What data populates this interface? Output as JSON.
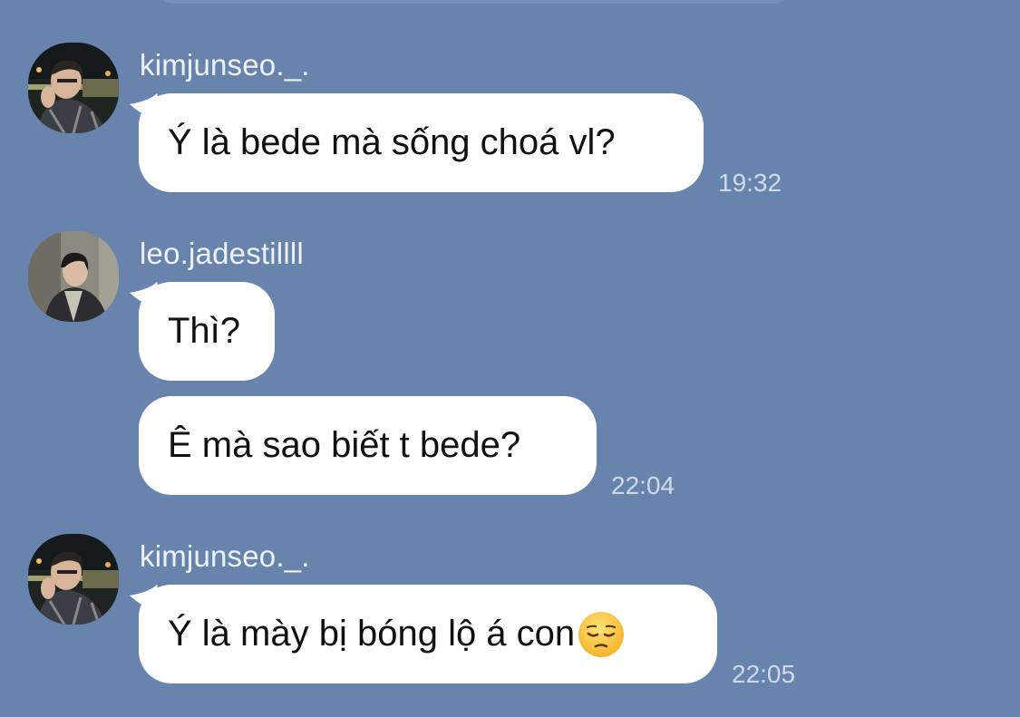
{
  "colors": {
    "background": "#6884ad",
    "bubble": "#ffffff",
    "username_text": "#eef2f8",
    "time_text": "#cfdae9"
  },
  "messages": [
    {
      "sender": "kimjunseo._.",
      "avatar": "avatar-kimjunseo",
      "bubbles": [
        {
          "text": "Ý là bede mà sống choá vl?"
        }
      ],
      "time": "19:32"
    },
    {
      "sender": "leo.jadestillll",
      "avatar": "avatar-leo",
      "bubbles": [
        {
          "text": "Thì?"
        },
        {
          "text": "Ê mà sao biết t bede?"
        }
      ],
      "time": "22:04"
    },
    {
      "sender": "kimjunseo._.",
      "avatar": "avatar-kimjunseo",
      "bubbles": [
        {
          "text": "Ý là mày bị bóng lộ á con",
          "emoji": "pensive-face-emoji"
        }
      ],
      "time": "22:05"
    }
  ]
}
